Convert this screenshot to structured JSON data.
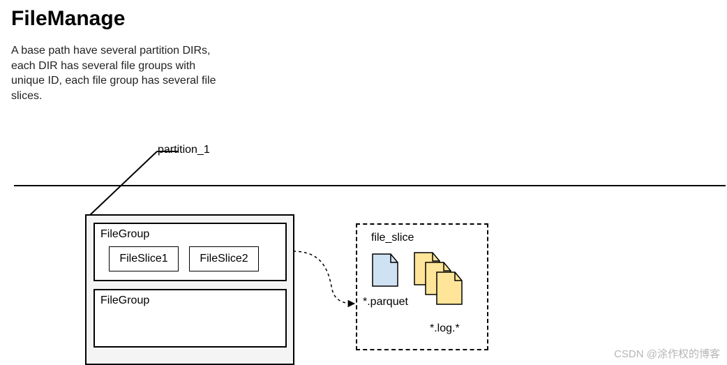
{
  "title": "FileManage",
  "description": "A base path have several partition DIRs, each DIR has several file groups with unique ID, each file group has several file slices.",
  "partition": {
    "label": "partition_1",
    "groups": [
      {
        "label": "FileGroup",
        "slices": [
          "FileSlice1",
          "FileSlice2"
        ]
      },
      {
        "label": "FileGroup",
        "slices": []
      }
    ]
  },
  "detail": {
    "title": "file_slice",
    "parquet_label": "*.parquet",
    "log_label": "*.log.*"
  },
  "watermark": "CSDN @涂作权的博客"
}
